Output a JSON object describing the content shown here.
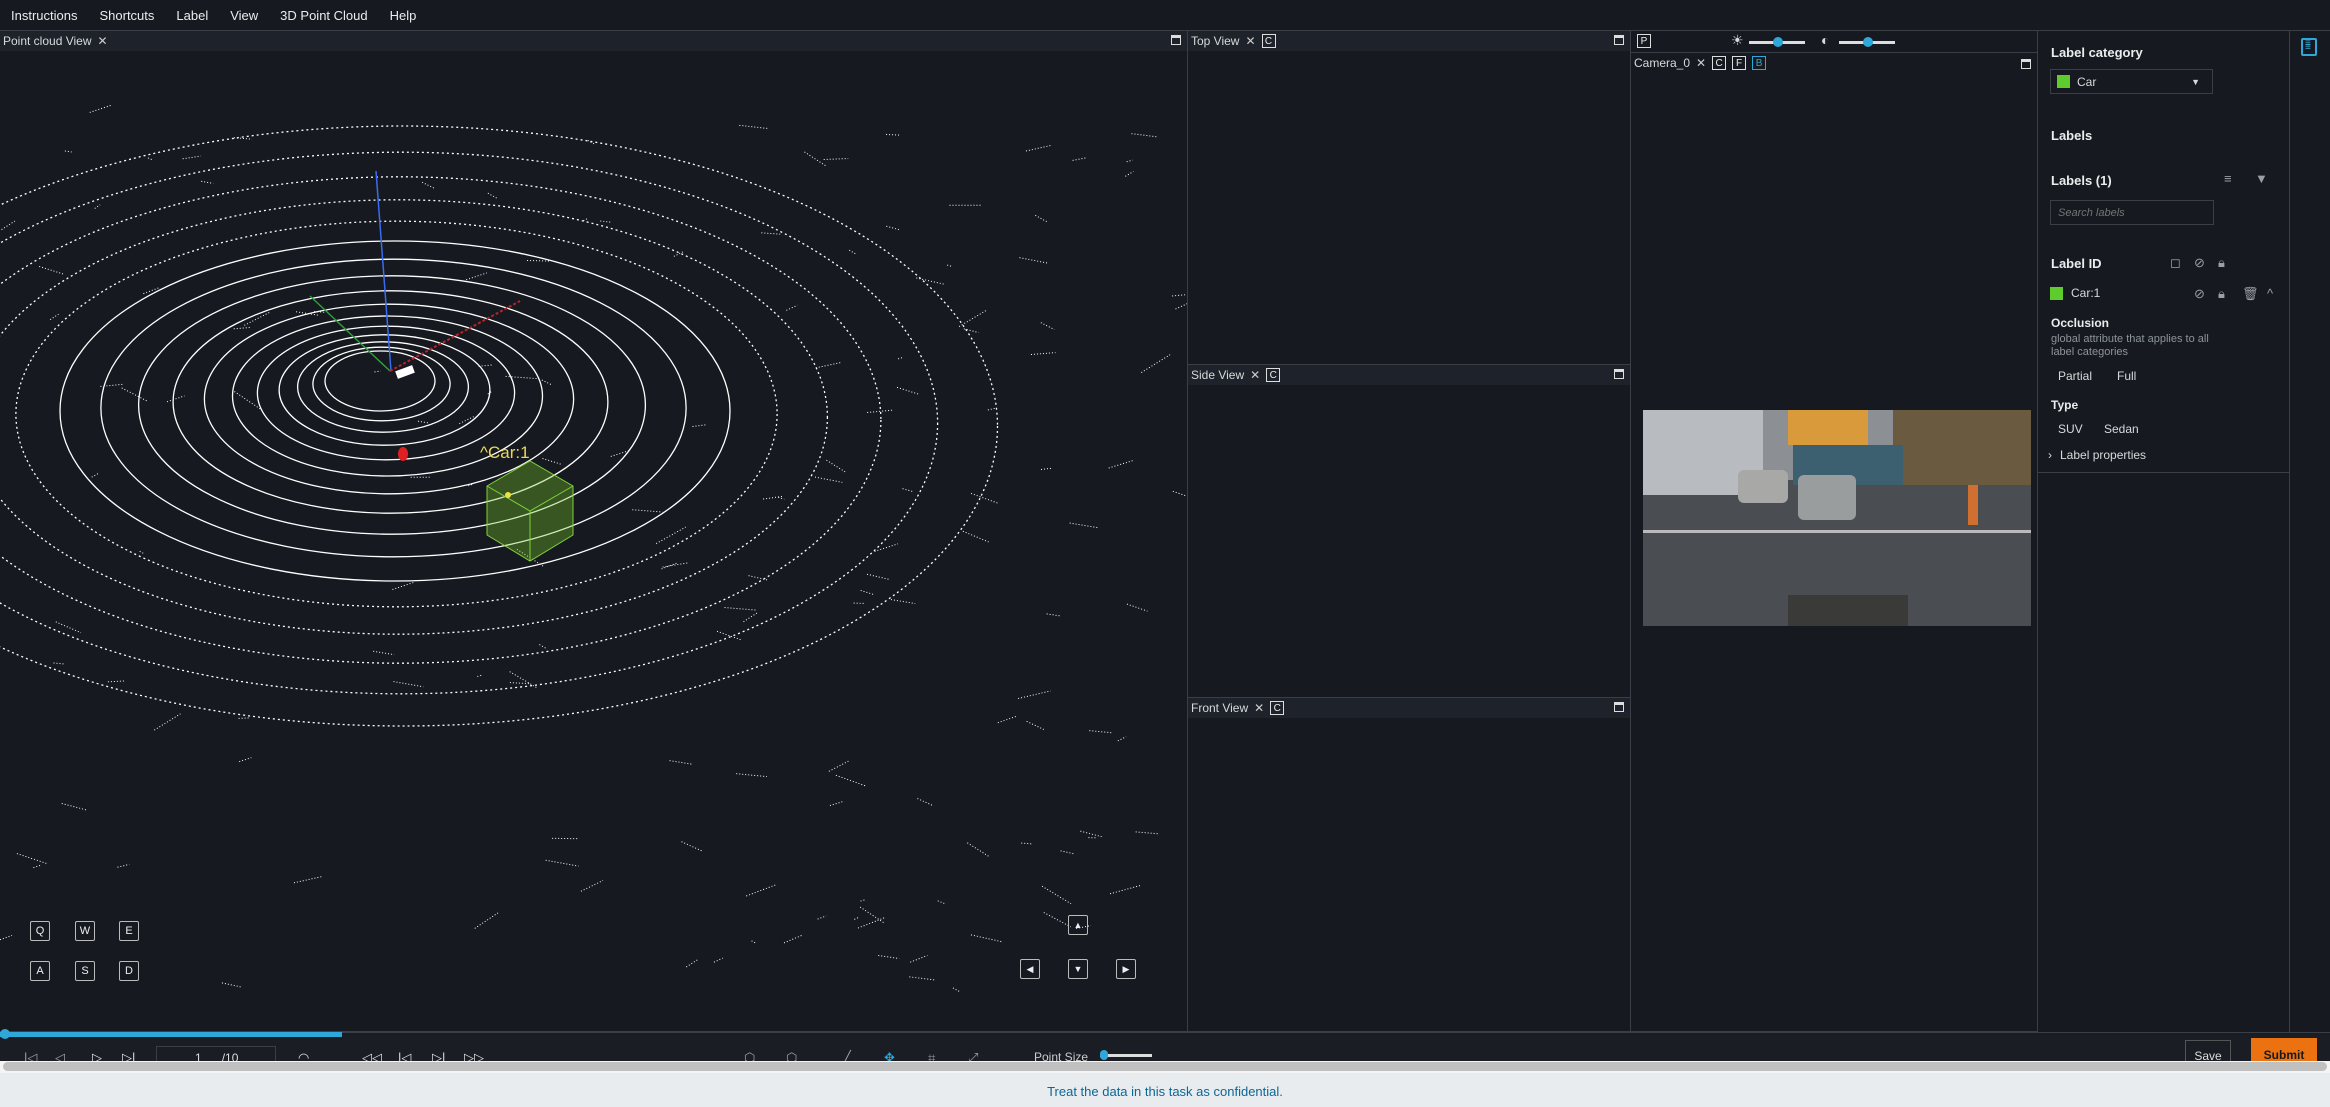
{
  "menu": [
    "Instructions",
    "Shortcuts",
    "Label",
    "View",
    "3D Point Cloud",
    "Help"
  ],
  "views": {
    "point_cloud": "Point cloud View",
    "top": "Top View",
    "side": "Side View",
    "front": "Front View",
    "camera": "Camera_0",
    "camera_buttons": [
      "C",
      "F",
      "B"
    ],
    "projection_button": "P",
    "view_button": "C"
  },
  "annotation_label": "^Car:1",
  "keys": {
    "row1": [
      "Q",
      "W",
      "E"
    ],
    "row2": [
      "A",
      "S",
      "D"
    ]
  },
  "sliders": {
    "brightness": 0.5,
    "contrast": 0.5,
    "point_size": 0.05
  },
  "sidebar": {
    "label_category_title": "Label category",
    "label_category_value": "Car",
    "category_color": "#5fcc2e",
    "labels_title": "Labels",
    "labels_count": "Labels (1)",
    "search_placeholder": "Search labels",
    "label_id_header": "Label ID",
    "label_item": "Car:1",
    "occlusion_title": "Occlusion",
    "occlusion_desc": "global attribute that applies to all label categories",
    "occlusion_options": [
      "Partial",
      "Full"
    ],
    "type_title": "Type",
    "type_options": [
      "SUV",
      "Sedan"
    ],
    "label_properties": "Label properties"
  },
  "playback": {
    "frame": "1",
    "total": "/10",
    "progress": 0.1
  },
  "toolbar": {
    "point_size_label": "Point Size",
    "save": "Save",
    "submit": "Submit",
    "submit_color": "#ec7211"
  },
  "footer": {
    "notice": "Treat the data in this task as confidential."
  }
}
